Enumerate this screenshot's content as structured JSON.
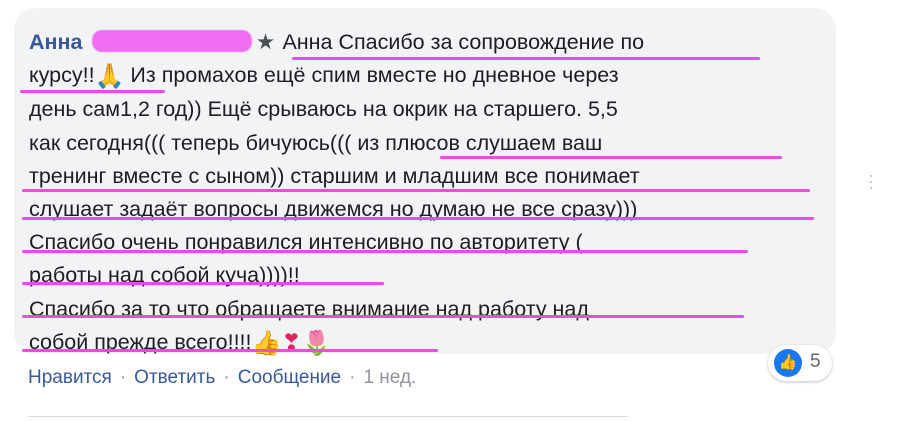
{
  "comment": {
    "author": "Анна",
    "text_line1": "Анна Спасибо за сопровождение по",
    "text_line2": "курсу!!",
    "text_line2b": " Из промахов ещё спим вместе но дневное через",
    "text_line3": "день сам1,2 год)) Ещё срываюсь на окрик на старшего. 5,5",
    "text_line4": "как сегодня((( теперь бичуюсь((( из плюсов слушаем ваш",
    "text_line5": "тренинг вместе с сыном)) старшим и младшим все понимает",
    "text_line6": "слушает задаёт вопросы движемся но думаю не все сразу)))",
    "text_line7": "Спасибо очень понравился интенсивно по авторитету (",
    "text_line8": "работы над собой куча))))!!",
    "text_line9": "Спасибо за то что обращаете внимание над работу над",
    "text_line10": "собой прежде всего!!!!"
  },
  "emojis": {
    "pray": "🙏",
    "thumbs_up": "👍",
    "heart": "❣",
    "tulip": "🌷",
    "star": "★"
  },
  "reactions": {
    "count": "5",
    "icon": "like-icon"
  },
  "actions": {
    "like": "Нравится",
    "reply": "Ответить",
    "message": "Сообщение",
    "time": "1 нед."
  },
  "colors": {
    "author": "#385898",
    "bubble": "#f2f3f5",
    "underline": "#e84ce4",
    "like_badge": "#1877f2"
  }
}
